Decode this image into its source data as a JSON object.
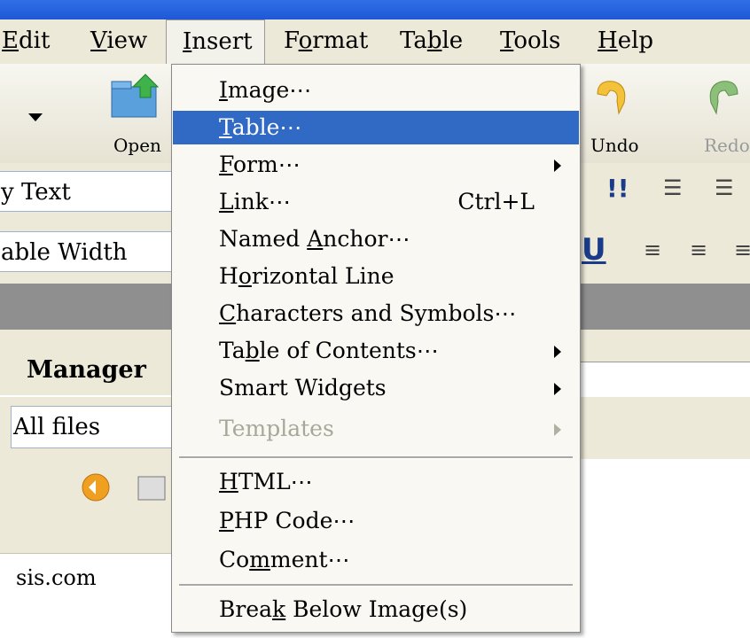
{
  "menubar": {
    "items": [
      {
        "label": "Edit",
        "ul": "E",
        "rest": "dit",
        "cut": true
      },
      {
        "label": "View",
        "ul": "V",
        "rest": "iew"
      },
      {
        "label": "Insert",
        "ul": "I",
        "rest": "nsert"
      },
      {
        "label": "Format",
        "pre": "F",
        "ul": "o",
        "rest": "rmat"
      },
      {
        "label": "Table",
        "pre": "Ta",
        "ul": "b",
        "rest": "le"
      },
      {
        "label": "Tools",
        "ul": "T",
        "rest": "ools"
      },
      {
        "label": "Help",
        "ul": "H",
        "rest": "elp"
      }
    ]
  },
  "toolbar": {
    "open_label": "Open",
    "undo_label": "Undo",
    "redo_label": "Redo",
    "style_field": "y Text",
    "width_field": "able Width"
  },
  "panel": {
    "manager_title": "Manager",
    "filter_value": "All files",
    "site_text": "sis.com"
  },
  "insert_menu": {
    "items": [
      {
        "pre": "",
        "ul": "I",
        "rest": "mage⋯"
      },
      {
        "pre": "",
        "ul": "T",
        "rest": "able⋯",
        "highlighted": true
      },
      {
        "pre": "",
        "ul": "F",
        "rest": "orm⋯",
        "submenu": true
      },
      {
        "pre": "",
        "ul": "L",
        "rest": "ink⋯",
        "shortcut": "Ctrl+L"
      },
      {
        "pre": "Named ",
        "ul": "A",
        "rest": "nchor⋯"
      },
      {
        "pre": "H",
        "ul": "o",
        "rest": "rizontal Line"
      },
      {
        "pre": "",
        "ul": "C",
        "rest": "haracters and Symbols⋯"
      },
      {
        "pre": "Ta",
        "ul": "b",
        "rest": "le of Contents⋯",
        "submenu": true
      },
      {
        "pre": "Smart Widgets",
        "ul": "",
        "rest": "",
        "submenu": true
      },
      {
        "pre": "Templates",
        "ul": "",
        "rest": "",
        "submenu": true,
        "disabled": true
      },
      {
        "pre": "",
        "ul": "H",
        "rest": "TML⋯"
      },
      {
        "pre": "",
        "ul": "P",
        "rest": "HP Code⋯"
      },
      {
        "pre": "Co",
        "ul": "m",
        "rest": "ment⋯"
      },
      {
        "pre": "Brea",
        "ul": "k",
        "rest": " Below Image(s)"
      }
    ]
  }
}
